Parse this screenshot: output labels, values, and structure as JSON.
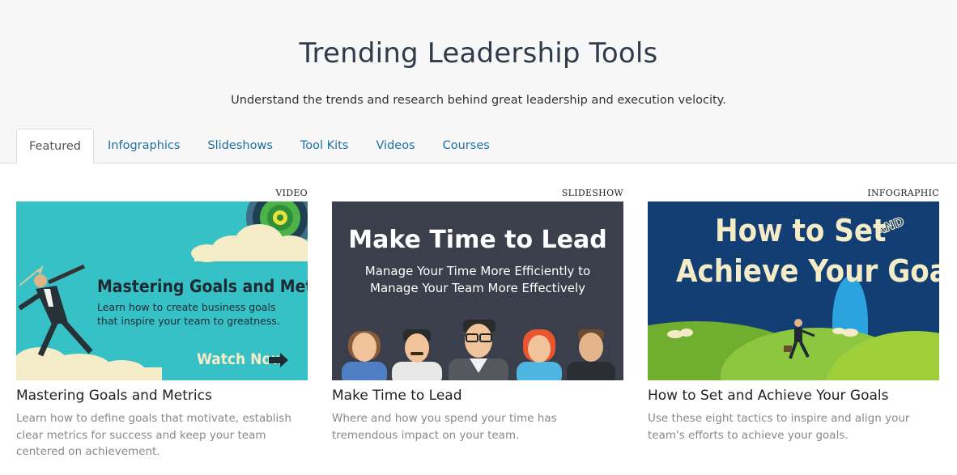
{
  "header": {
    "title": "Trending Leadership Tools",
    "subtitle": "Understand the trends and research behind great leadership and execution velocity."
  },
  "tabs": [
    {
      "label": "Featured",
      "active": true
    },
    {
      "label": "Infographics"
    },
    {
      "label": "Slideshows"
    },
    {
      "label": "Tool Kits"
    },
    {
      "label": "Videos"
    },
    {
      "label": "Courses"
    }
  ],
  "colors": {
    "link": "#1f6fa3",
    "title": "#2f3b4a",
    "teal": "#35c1c5",
    "slate": "#3a3f4b",
    "navy": "#123e73"
  },
  "cards": [
    {
      "type": "VIDEO",
      "title": "Mastering Goals and Metrics",
      "description": "Learn how to define goals that motivate, establish clear metrics for success and keep your team centered on achievement.",
      "thumb": {
        "heading": "Mastering Goals and Metrics",
        "line1": "Learn how to create business goals",
        "line2": "that inspire your team to greatness.",
        "cta": "Watch Now"
      }
    },
    {
      "type": "SLIDESHOW",
      "title": "Make Time to Lead",
      "description": "Where and how you spend your time has tremendous impact on your team.",
      "thumb": {
        "heading": "Make Time to Lead",
        "line1": "Manage Your Time More Efficiently to",
        "line2": "Manage Your Team More Effectively"
      }
    },
    {
      "type": "INFOGRAPHIC",
      "title": "How to Set and Achieve Your Goals",
      "description": "Use these eight tactics to inspire and align your team's efforts to achieve your goals.",
      "thumb": {
        "line1": "How to Set",
        "and": "AND",
        "line2": "Achieve Your Goals"
      }
    }
  ]
}
